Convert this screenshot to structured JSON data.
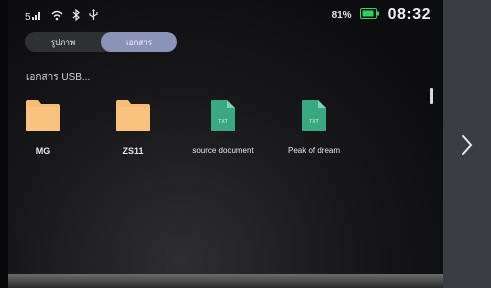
{
  "status_bar": {
    "battery_percent": "81%",
    "time": "08:32",
    "icons": [
      "signal-icon",
      "wifi-icon",
      "bluetooth-icon",
      "usb-icon",
      "battery-icon"
    ]
  },
  "tabs": [
    {
      "label": "รูปภาพ",
      "active": false
    },
    {
      "label": "เอกสาร",
      "active": true
    }
  ],
  "section_title": "เอกสาร USB...",
  "items": [
    {
      "type": "folder",
      "label": "MG"
    },
    {
      "type": "folder",
      "label": "ZS11"
    },
    {
      "type": "file",
      "label": "source document",
      "badge": "TXT"
    },
    {
      "type": "file",
      "label": "Peak of dream",
      "badge": "TXT"
    }
  ],
  "colors": {
    "folder": "#f7bd74",
    "file": "#3aa881",
    "active_tab": "#8c93b8",
    "battery": "#2fd35a"
  }
}
